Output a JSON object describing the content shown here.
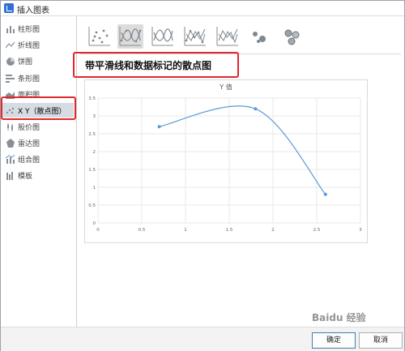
{
  "window": {
    "title": "插入图表"
  },
  "sidebar": {
    "items": [
      {
        "label": "柱形图",
        "icon": "column-chart-icon"
      },
      {
        "label": "折线图",
        "icon": "line-chart-icon"
      },
      {
        "label": "饼图",
        "icon": "pie-chart-icon"
      },
      {
        "label": "条形图",
        "icon": "bar-chart-icon"
      },
      {
        "label": "面积图",
        "icon": "area-chart-icon"
      },
      {
        "label": "X Y（散点图）",
        "icon": "scatter-chart-icon",
        "selected": true
      },
      {
        "label": "股价图",
        "icon": "stock-chart-icon"
      },
      {
        "label": "雷达图",
        "icon": "radar-chart-icon"
      },
      {
        "label": "组合图",
        "icon": "combo-chart-icon"
      },
      {
        "label": "模板",
        "icon": "template-icon"
      }
    ]
  },
  "subtypes": [
    {
      "icon": "scatter-markers-icon",
      "selected": false
    },
    {
      "icon": "scatter-smooth-markers-icon",
      "selected": true
    },
    {
      "icon": "scatter-smooth-lines-icon",
      "selected": false
    },
    {
      "icon": "scatter-straight-markers-icon",
      "selected": false
    },
    {
      "icon": "scatter-straight-lines-icon",
      "selected": false
    },
    {
      "icon": "bubble-icon",
      "selected": false
    },
    {
      "icon": "bubble-3d-icon",
      "selected": false
    }
  ],
  "subtype_title": "带平滑线和数据标记的散点图",
  "chart_data": {
    "type": "scatter",
    "style": "smooth-lines-with-markers",
    "title": "Y 值",
    "xlim": [
      0,
      3
    ],
    "ylim": [
      0,
      3.5
    ],
    "x_ticks": [
      "0",
      "0.5",
      "1",
      "1.5",
      "2",
      "2.5",
      "3"
    ],
    "y_ticks": [
      "0",
      "0.5",
      "1",
      "1.5",
      "2",
      "2.5",
      "3",
      "3.5"
    ],
    "series": [
      {
        "values": [
          {
            "x": 0.7,
            "y": 2.7
          },
          {
            "x": 1.8,
            "y": 3.2
          },
          {
            "x": 2.6,
            "y": 0.8
          }
        ]
      }
    ],
    "grid": true,
    "line_color": "#5b9bd5"
  },
  "buttons": {
    "ok": "确定",
    "cancel": "取消"
  },
  "watermark": "Baidu 经验",
  "colors": {
    "highlight": "#e0282e",
    "accent": "#5b9bd5"
  }
}
